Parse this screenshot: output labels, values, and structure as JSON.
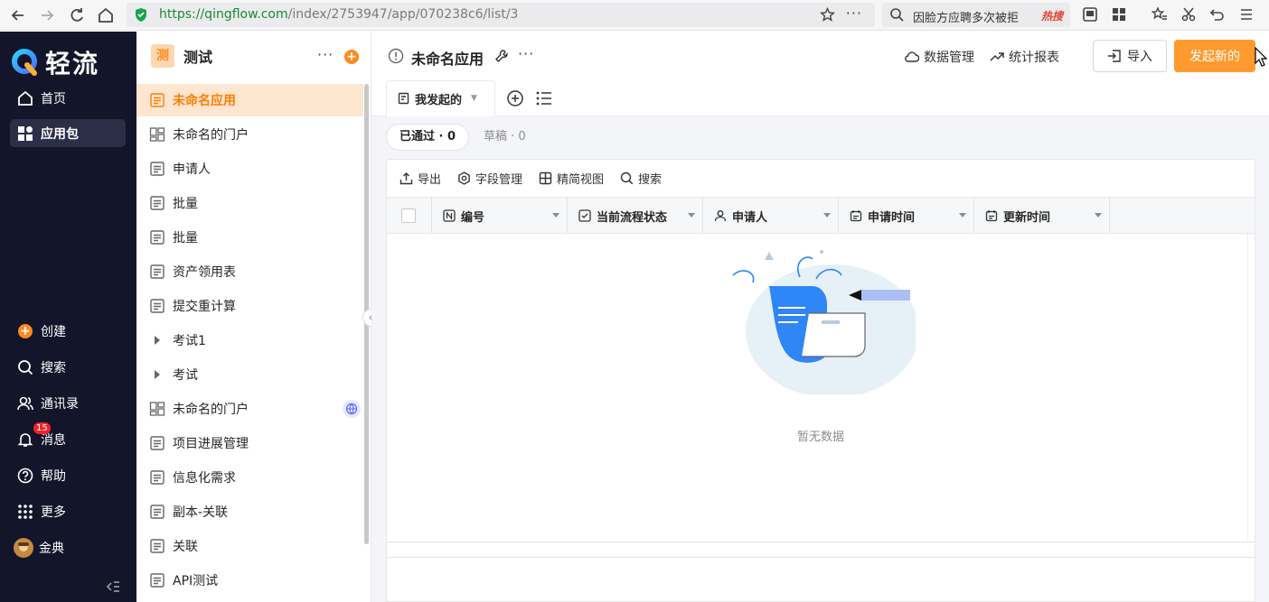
{
  "browser": {
    "url_host": "https://qingflow.com",
    "url_path": "/index/2753947/app/070238c6/list/3",
    "search_query": "因脸方应聘多次被拒",
    "search_hot": "热搜"
  },
  "nav": {
    "brand": "轻流",
    "top_items": [
      {
        "label": "首页",
        "icon": "home-icon"
      },
      {
        "label": "应用包",
        "icon": "grid-icon",
        "active": true
      }
    ],
    "bottom_items": [
      {
        "label": "创建",
        "icon": "plus-circle-icon"
      },
      {
        "label": "搜索",
        "icon": "search-icon"
      },
      {
        "label": "通讯录",
        "icon": "contacts-icon"
      },
      {
        "label": "消息",
        "icon": "bell-icon",
        "badge": "15"
      },
      {
        "label": "帮助",
        "icon": "help-icon"
      },
      {
        "label": "更多",
        "icon": "dots-grid-icon"
      },
      {
        "label": "金典",
        "icon": "avatar"
      }
    ]
  },
  "package": {
    "icon_text": "测",
    "name": "测试",
    "apps": [
      {
        "label": "未命名应用",
        "type": "form",
        "active": true
      },
      {
        "label": "未命名的门户",
        "type": "portal"
      },
      {
        "label": "申请人",
        "type": "form"
      },
      {
        "label": "批量",
        "type": "form"
      },
      {
        "label": "批量",
        "type": "form"
      },
      {
        "label": "资产领用表",
        "type": "form"
      },
      {
        "label": "提交重计算",
        "type": "form"
      },
      {
        "label": "考试1",
        "type": "folder"
      },
      {
        "label": "考试",
        "type": "folder"
      },
      {
        "label": "未命名的门户",
        "type": "portal",
        "globe": true
      },
      {
        "label": "项目进展管理",
        "type": "form"
      },
      {
        "label": "信息化需求",
        "type": "form"
      },
      {
        "label": "副本-关联",
        "type": "form"
      },
      {
        "label": "关联",
        "type": "form"
      },
      {
        "label": "API测试",
        "type": "form"
      }
    ]
  },
  "main": {
    "app_title": "未命名应用",
    "data_manage": "数据管理",
    "stats_report": "统计报表",
    "import_label": "导入",
    "launch_label": "发起新的",
    "tab_label": "我发起的",
    "filters": {
      "approved": "已通过 · 0",
      "draft": "草稿 · 0"
    },
    "toolbar": {
      "export": "导出",
      "fields": "字段管理",
      "compact": "精简视图",
      "search": "搜索"
    },
    "columns": [
      {
        "label": "编号",
        "icon": "number-field-icon"
      },
      {
        "label": "当前流程状态",
        "icon": "checkbox-field-icon"
      },
      {
        "label": "申请人",
        "icon": "person-field-icon"
      },
      {
        "label": "申请时间",
        "icon": "calendar-field-icon"
      },
      {
        "label": "更新时间",
        "icon": "calendar-field-icon"
      }
    ],
    "empty_text": "暂无数据"
  },
  "colors": {
    "accent": "#ff8a1f",
    "nav_bg": "#13152a",
    "primary_btn": "#ff9a2e",
    "illustration_blue": "#2f86f6"
  }
}
